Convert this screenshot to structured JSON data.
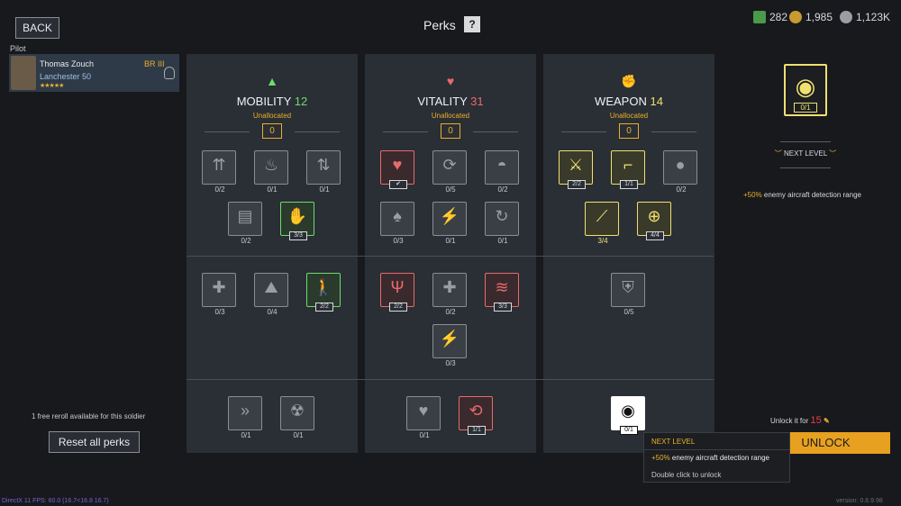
{
  "header": {
    "back": "BACK",
    "title": "Perks",
    "help": "?"
  },
  "currency": {
    "gold_bars": "282",
    "gold": "1,985",
    "silver": "1,123K"
  },
  "pilot": {
    "label": "Pilot",
    "name": "Thomas Zouch",
    "br": "BR III",
    "vehicle": "Lanchester 50",
    "stars": "★★★★★"
  },
  "columns": [
    {
      "name": "MOBILITY",
      "points": "12",
      "unallocated": "Unallocated",
      "value": "0",
      "color": "#6cdc6c"
    },
    {
      "name": "VITALITY",
      "points": "31",
      "unallocated": "Unallocated",
      "value": "0",
      "color": "#e86a6a"
    },
    {
      "name": "WEAPON",
      "points": "14",
      "unallocated": "Unallocated",
      "value": "0",
      "color": "#f0e070"
    }
  ],
  "perks": {
    "m1": "0/2",
    "m2": "0/1",
    "m3": "0/1",
    "m4": "0/2",
    "m5": "3/3",
    "m6": "0/3",
    "m7": "0/4",
    "m8": "2/2",
    "m9": "0/1",
    "m10": "0/1",
    "v1": "✔",
    "v2": "0/5",
    "v3": "0/2",
    "v4": "0/3",
    "v5": "0/1",
    "v6": "0/1",
    "v7": "2/2",
    "v8": "0/2",
    "v9": "3/3",
    "v10": "0/3",
    "v11": "0/1",
    "v12": "1/1",
    "w1": "2/2",
    "w2": "1/1",
    "w3": "0/2",
    "w4": "3/4",
    "w5": "4/4",
    "w6": "0/5",
    "w7": "0/1"
  },
  "selected": {
    "count": "0/1",
    "next_level": "NEXT LEVEL",
    "bonus": "+50%",
    "description": " enemy aircraft detection range"
  },
  "unlock": {
    "label": "Unlock it for",
    "price": "15",
    "button": "UNLOCK"
  },
  "left": {
    "reroll": "1 free reroll available for this soldier",
    "reset": "Reset all perks"
  },
  "tooltip": {
    "title": "NEXT LEVEL",
    "bonus": "+50%",
    "text": " enemy aircraft detection range",
    "hint": "Double click to unlock"
  },
  "footer": {
    "fps": "DirectX 11 FPS: 60.0 (16.7<16.8 16.7)",
    "version": "version: 0.6.9.98"
  }
}
